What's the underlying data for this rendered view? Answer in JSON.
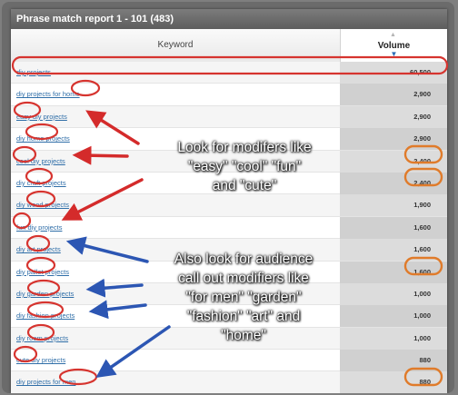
{
  "report": {
    "title": "Phrase match report 1 - 101 (483)",
    "col_keyword": "Keyword",
    "col_volume": "Volume",
    "rows": [
      {
        "keyword": "diy projects",
        "volume": "60,500"
      },
      {
        "keyword": "diy projects for home",
        "volume": "2,900"
      },
      {
        "keyword": "easy diy projects",
        "volume": "2,900"
      },
      {
        "keyword": "diy home projects",
        "volume": "2,900"
      },
      {
        "keyword": "cool diy projects",
        "volume": "2,400"
      },
      {
        "keyword": "diy craft projects",
        "volume": "2,400"
      },
      {
        "keyword": "diy wood projects",
        "volume": "1,900"
      },
      {
        "keyword": "fun diy projects",
        "volume": "1,600"
      },
      {
        "keyword": "diy art projects",
        "volume": "1,600"
      },
      {
        "keyword": "diy pallet projects",
        "volume": "1,600"
      },
      {
        "keyword": "diy garden projects",
        "volume": "1,000"
      },
      {
        "keyword": "diy fashion projects",
        "volume": "1,000"
      },
      {
        "keyword": "diy room projects",
        "volume": "1,000"
      },
      {
        "keyword": "cute diy projects",
        "volume": "880"
      },
      {
        "keyword": "diy projects for men",
        "volume": "880"
      }
    ]
  },
  "annotations": {
    "note1": [
      "Look for modifers like",
      "\"easy\" \"cool\" \"fun\"",
      "and \"cute\""
    ],
    "note2": [
      "Also look for audience",
      "call out modifiers like",
      "\"for men\" \"garden\"",
      "\"fashion\" \"art\" and",
      "\"home\""
    ],
    "circle_color": "#d6342f",
    "volume_circle_color": "#e07b2a",
    "arrow_red": "#d42b2b",
    "arrow_blue": "#2c56b3"
  }
}
